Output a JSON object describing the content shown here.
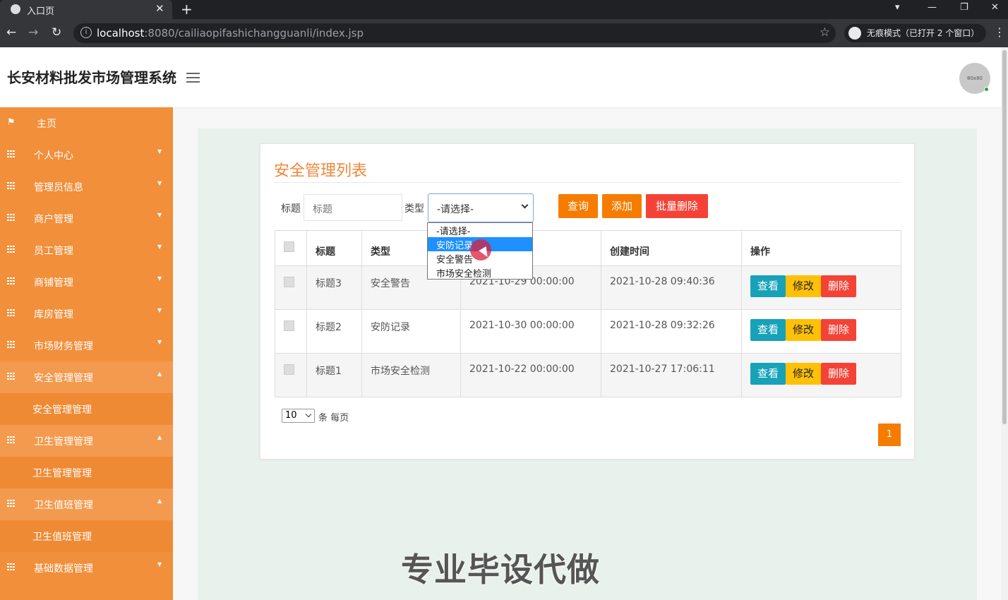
{
  "browser": {
    "tab_title": "入口页",
    "tab_close": "✕",
    "new_tab": "+",
    "url_host": "localhost",
    "url_path": ":8080/cailiaopifashichangguanli/index.jsp",
    "incognito_label": "无痕模式（已打开 2 个窗口）"
  },
  "header": {
    "brand": "长安材料批发市场管理系统",
    "avatar_text": "80x80"
  },
  "sidebar": {
    "items": [
      {
        "label": "主页",
        "icon": "flag-icon"
      },
      {
        "label": "个人中心",
        "icon": "grid-icon"
      },
      {
        "label": "管理员信息",
        "icon": "grid-icon"
      },
      {
        "label": "商户管理",
        "icon": "grid-icon"
      },
      {
        "label": "员工管理",
        "icon": "grid-icon"
      },
      {
        "label": "商铺管理",
        "icon": "grid-icon"
      },
      {
        "label": "库房管理",
        "icon": "grid-icon"
      },
      {
        "label": "市场财务管理",
        "icon": "grid-icon"
      },
      {
        "label": "安全管理管理",
        "icon": "grid-icon",
        "open": true,
        "sub": "安全管理管理"
      },
      {
        "label": "卫生管理管理",
        "icon": "grid-icon",
        "open": true,
        "sub": "卫生管理管理"
      },
      {
        "label": "卫生值班管理",
        "icon": "grid-icon",
        "open": true,
        "sub": "卫生值班管理"
      },
      {
        "label": "基础数据管理",
        "icon": "grid-icon"
      }
    ]
  },
  "main": {
    "title": "安全管理列表",
    "filters": {
      "title_label": "标题",
      "title_placeholder": "标题",
      "type_label": "类型",
      "type_selected": "-请选择-",
      "type_options": [
        "-请选择-",
        "安防记录",
        "安全警告",
        "市场安全检测"
      ],
      "highlighted_option": "安防记录"
    },
    "buttons": {
      "search": "查询",
      "add": "添加",
      "batch_delete": "批量删除"
    },
    "table": {
      "columns": [
        "标题",
        "类型",
        "",
        "创建时间",
        "操作"
      ],
      "rows": [
        {
          "title": "标题3",
          "type": "安全警告",
          "date": "2021-10-29 00:00:00",
          "created": "2021-10-28 09:40:36"
        },
        {
          "title": "标题2",
          "type": "安防记录",
          "date": "2021-10-30 00:00:00",
          "created": "2021-10-28 09:32:26"
        },
        {
          "title": "标题1",
          "type": "市场安全检测",
          "date": "2021-10-22 00:00:00",
          "created": "2021-10-27 17:06:11"
        }
      ],
      "actions": {
        "view": "查看",
        "edit": "修改",
        "delete": "删除"
      }
    },
    "pagination": {
      "per_page": "10",
      "per_page_suffix": "条 每页",
      "current_page": "1"
    },
    "watermark": "专业毕设代做"
  },
  "colors": {
    "sidebar": "#f18f3b",
    "accent": "#f0873a",
    "view": "#17a2b8",
    "edit": "#ffc107",
    "delete": "#f44336"
  }
}
